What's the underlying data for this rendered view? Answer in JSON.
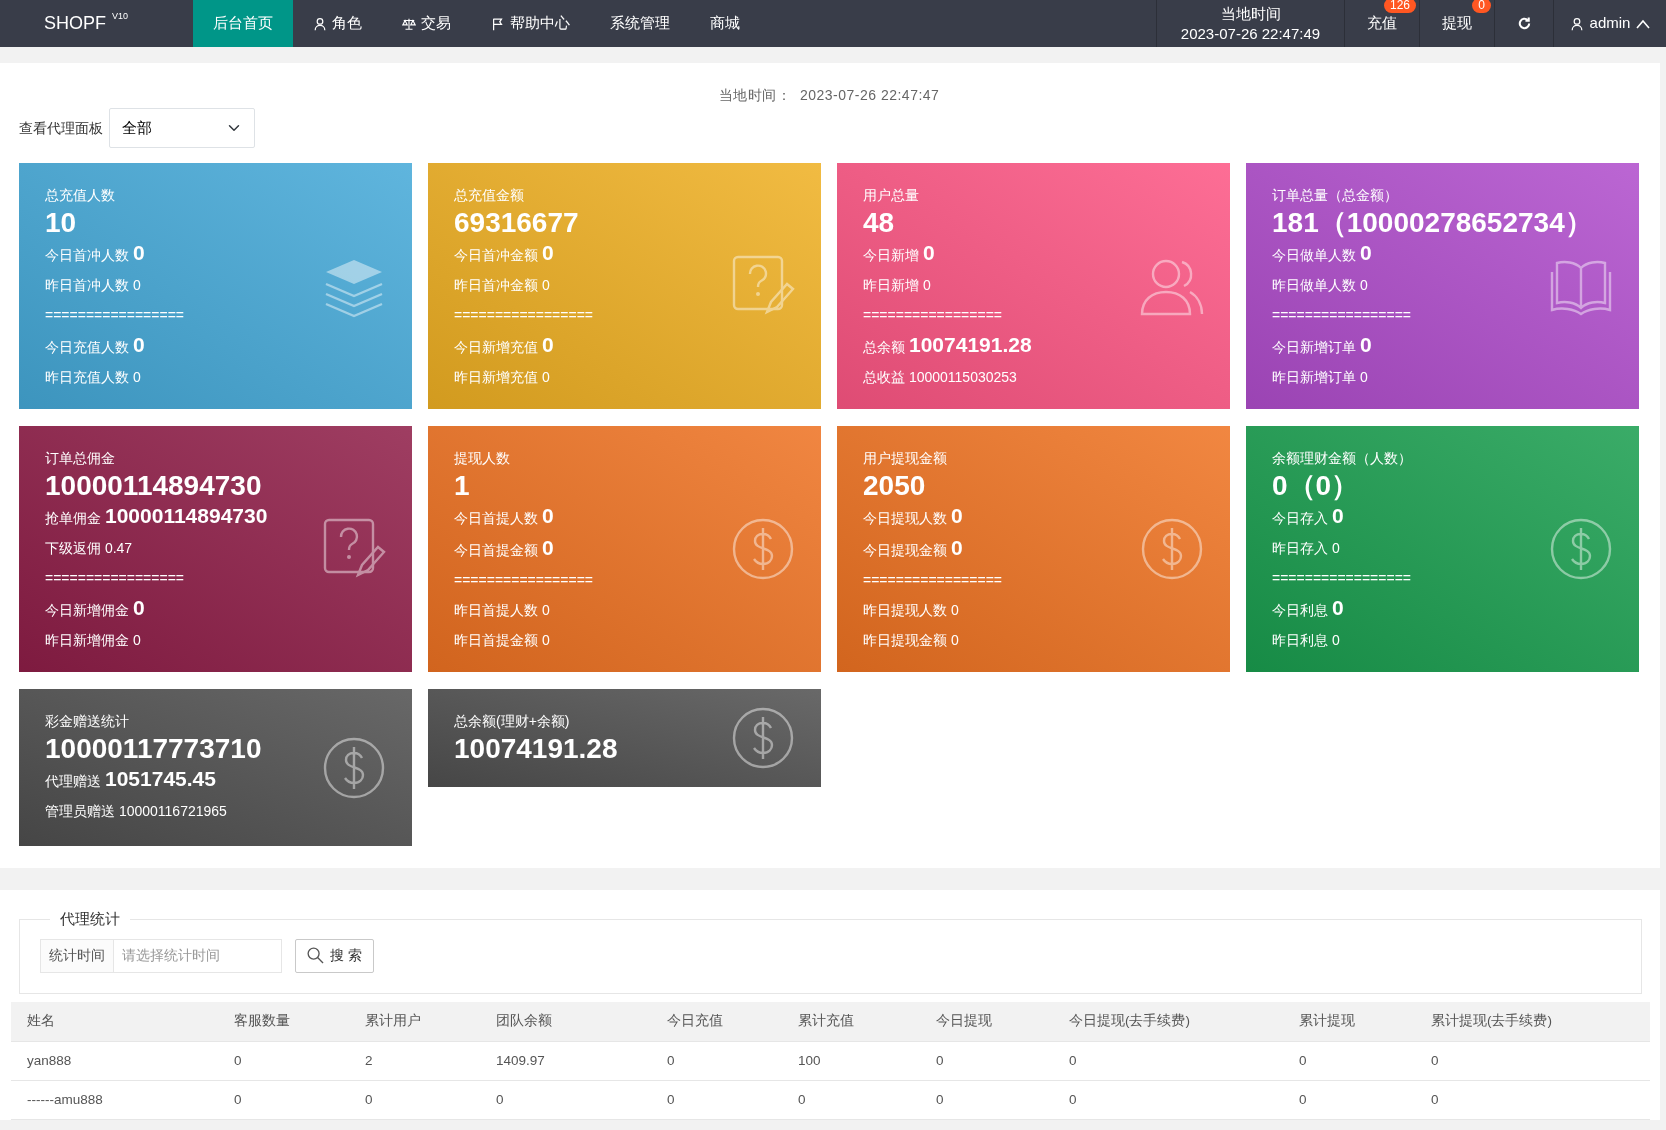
{
  "navbar": {
    "logo": "SHOPF",
    "logo_sup": "V10",
    "items": [
      {
        "label": "后台首页",
        "selected": true
      },
      {
        "label": "角色",
        "selected": false
      },
      {
        "label": "交易",
        "selected": false
      },
      {
        "label": "帮助中心",
        "selected": false
      },
      {
        "label": "系统管理",
        "selected": false
      },
      {
        "label": "商城",
        "selected": false
      }
    ],
    "clock": {
      "label": "当地时间",
      "time": "2023-07-26 22:47:49"
    },
    "actions": [
      {
        "label": "充值",
        "badge": "126"
      },
      {
        "label": "提现",
        "badge": "0"
      }
    ],
    "user": {
      "name": "admin"
    }
  },
  "local_time": {
    "label": "当地时间：",
    "value": "2023-07-26 22:47:47"
  },
  "agent_filter": {
    "label": "查看代理面板",
    "value": "全部"
  },
  "cards": [
    {
      "title": "总充值人数",
      "value": "10",
      "color": "#45a9d8",
      "lines": [
        {
          "kind": "big",
          "label": "今日首冲人数",
          "value": "0"
        },
        {
          "kind": "small",
          "label": "昨日首冲人数",
          "value": "0"
        },
        {
          "kind": "divider",
          "text": "================="
        },
        {
          "kind": "big",
          "label": "今日充值人数",
          "value": "0"
        },
        {
          "kind": "small",
          "label": "昨日充值人数",
          "value": "0"
        }
      ]
    },
    {
      "title": "总充值金额",
      "value": "69316677",
      "color": "#efb023",
      "lines": [
        {
          "kind": "big",
          "label": "今日首冲金额",
          "value": "0"
        },
        {
          "kind": "small",
          "label": "昨日首冲金额",
          "value": "0"
        },
        {
          "kind": "divider",
          "text": "================="
        },
        {
          "kind": "big",
          "label": "今日新增充值",
          "value": "0"
        },
        {
          "kind": "small",
          "label": "昨日新增充值",
          "value": "0"
        }
      ]
    },
    {
      "title": "用户总量",
      "value": "48",
      "color": "#fd5684",
      "lines": [
        {
          "kind": "big",
          "label": "今日新增",
          "value": "0"
        },
        {
          "kind": "small",
          "label": "昨日新增",
          "value": "0"
        },
        {
          "kind": "divider",
          "text": "================="
        },
        {
          "kind": "big",
          "label": "总余额",
          "value": "10074191.28"
        },
        {
          "kind": "small",
          "label": "总收益",
          "value": "10000115030253"
        }
      ]
    },
    {
      "title": "订单总量（总金额）",
      "value": "181（10000278652734）",
      "color": "#b04dcc",
      "lines": [
        {
          "kind": "big",
          "label": "今日做单人数",
          "value": "0"
        },
        {
          "kind": "small",
          "label": "昨日做单人数",
          "value": "0"
        },
        {
          "kind": "divider",
          "text": "================="
        },
        {
          "kind": "big",
          "label": "今日新增订单",
          "value": "0"
        },
        {
          "kind": "small",
          "label": "昨日新增订单",
          "value": "0"
        }
      ]
    },
    {
      "title": "订单总佣金",
      "value": "10000114894730",
      "color": "#8f1e48",
      "lines": [
        {
          "kind": "big",
          "label": "抢单佣金",
          "value": "10000114894730"
        },
        {
          "kind": "small",
          "label": "下级返佣",
          "value": "0.47"
        },
        {
          "kind": "divider",
          "text": "================="
        },
        {
          "kind": "big",
          "label": "今日新增佣金",
          "value": "0"
        },
        {
          "kind": "small",
          "label": "昨日新增佣金",
          "value": "0"
        }
      ]
    },
    {
      "title": "提现人数",
      "value": "1",
      "color": "#ee7222",
      "lines": [
        {
          "kind": "big",
          "label": "今日首提人数",
          "value": "0"
        },
        {
          "kind": "big",
          "label": "今日首提金额",
          "value": "0"
        },
        {
          "kind": "divider",
          "text": "================="
        },
        {
          "kind": "small",
          "label": "昨日首提人数",
          "value": "0"
        },
        {
          "kind": "small",
          "label": "昨日首提金额",
          "value": "0"
        }
      ]
    },
    {
      "title": "用户提现金额",
      "value": "2050",
      "color": "#ef7322",
      "lines": [
        {
          "kind": "big",
          "label": "今日提现人数",
          "value": "0"
        },
        {
          "kind": "big",
          "label": "今日提现金额",
          "value": "0"
        },
        {
          "kind": "divider",
          "text": "================="
        },
        {
          "kind": "small",
          "label": "昨日提现人数",
          "value": "0"
        },
        {
          "kind": "small",
          "label": "昨日提现金额",
          "value": "0"
        }
      ]
    },
    {
      "title": "余额理财金额（人数）",
      "value": "0（0）",
      "color": "#1a9e4f",
      "lines": [
        {
          "kind": "big",
          "label": "今日存入",
          "value": "0"
        },
        {
          "kind": "small",
          "label": "昨日存入",
          "value": "0"
        },
        {
          "kind": "divider",
          "text": "================="
        },
        {
          "kind": "big",
          "label": "今日利息",
          "value": "0"
        },
        {
          "kind": "small",
          "label": "昨日利息",
          "value": "0"
        }
      ]
    },
    {
      "title": "彩金赠送统计",
      "value": "10000117773710",
      "color": "#4f4f4f",
      "lines": [
        {
          "kind": "big",
          "label": "代理赠送",
          "value": "1051745.45"
        },
        {
          "kind": "small",
          "label": "管理员赠送",
          "value": "10000116721965"
        }
      ]
    },
    {
      "title": "总余额(理财+余额)",
      "value": "10074191.28",
      "color": "#505050"
    }
  ],
  "agent_stats": {
    "legend": "代理统计",
    "date_label": "统计时间",
    "placeholder": "请选择统计时间",
    "search_button": "搜 索"
  },
  "table": {
    "columns": [
      "姓名",
      "客服数量",
      "累计用户",
      "团队余额",
      "今日充值",
      "累计充值",
      "今日提现",
      "今日提现(去手续费)",
      "累计提现",
      "累计提现(去手续费)"
    ],
    "rows": [
      [
        "yan888",
        "0",
        "2",
        "1409.97",
        "0",
        "100",
        "0",
        "0",
        "0",
        "0"
      ],
      [
        "------amu888",
        "0",
        "0",
        "0",
        "0",
        "0",
        "0",
        "0",
        "0",
        "0"
      ]
    ]
  }
}
